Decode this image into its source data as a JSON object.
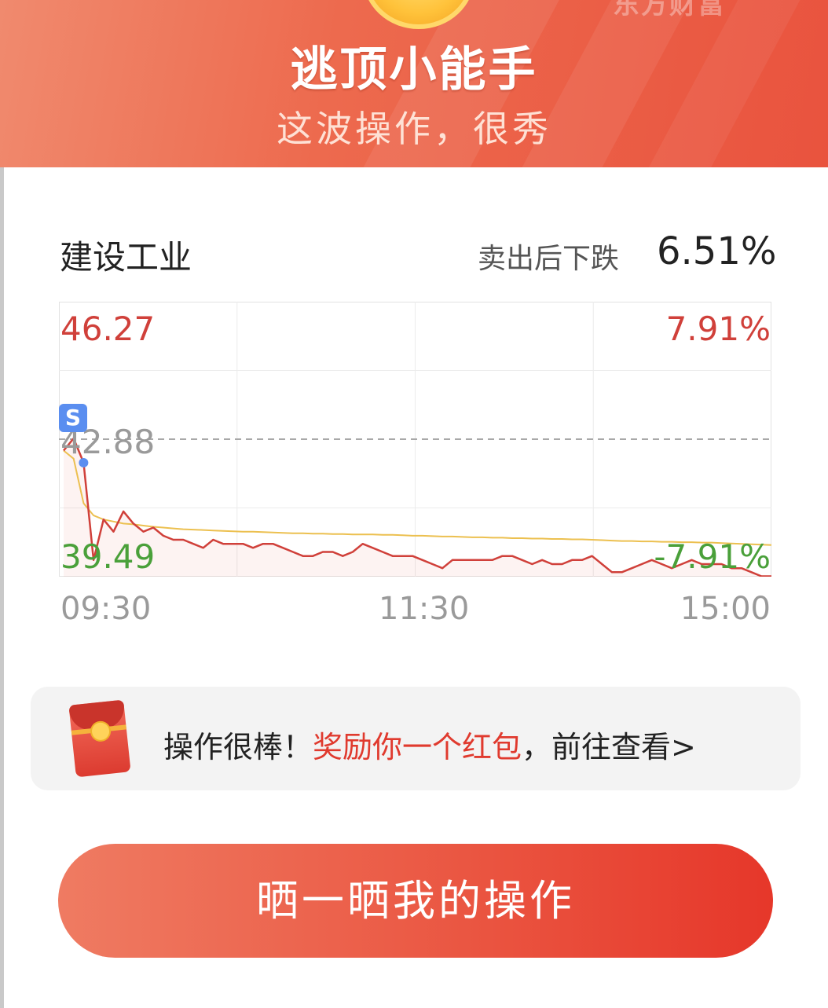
{
  "header": {
    "watermark": "东方财富",
    "title": "逃顶小能手",
    "subtitle": "这波操作，很秀"
  },
  "stock": {
    "name": "建设工业",
    "drop_label": "卖出后下跌",
    "drop_value": "6.51%"
  },
  "chart_data": {
    "type": "line",
    "y_labels": {
      "high": "46.27",
      "mid": "42.88",
      "low": "39.49",
      "high_pct": "7.91%",
      "low_pct": "-7.91%"
    },
    "ylim": [
      39.49,
      46.27
    ],
    "prev_close": 42.88,
    "x_ticks": [
      "09:30",
      "11:30",
      "15:00"
    ],
    "sell_marker": {
      "label": "S",
      "time_index": 2,
      "price": 42.3
    },
    "series": [
      {
        "values": [
          42.6,
          42.9,
          42.3,
          39.9,
          40.9,
          40.6,
          41.1,
          40.8,
          40.6,
          40.7,
          40.5,
          40.4,
          40.4,
          40.3,
          40.2,
          40.4,
          40.3,
          40.3,
          40.3,
          40.2,
          40.3,
          40.3,
          40.2,
          40.1,
          40.0,
          40.0,
          40.1,
          40.1,
          40.0,
          40.1,
          40.3,
          40.2,
          40.1,
          40.0,
          40.0,
          40.0,
          39.9,
          39.8,
          39.7,
          39.9,
          39.9,
          39.9,
          39.9,
          39.9,
          40.0,
          40.0,
          39.9,
          39.8,
          39.9,
          39.8,
          39.8,
          39.9,
          39.9,
          40.0,
          39.8,
          39.6,
          39.6,
          39.7,
          39.8,
          39.9,
          39.8,
          39.7,
          39.8,
          39.9,
          39.8,
          39.8,
          39.8,
          39.7,
          39.7,
          39.6,
          39.5,
          39.5
        ]
      },
      {
        "values": [
          42.6,
          42.4,
          41.3,
          41.0,
          40.9,
          40.85,
          40.8,
          40.78,
          40.75,
          40.72,
          40.7,
          40.68,
          40.66,
          40.65,
          40.64,
          40.63,
          40.62,
          40.61,
          40.6,
          40.6,
          40.59,
          40.58,
          40.57,
          40.56,
          40.56,
          40.55,
          40.55,
          40.54,
          40.54,
          40.53,
          40.53,
          40.53,
          40.52,
          40.52,
          40.51,
          40.5,
          40.5,
          40.49,
          40.48,
          40.48,
          40.47,
          40.46,
          40.46,
          40.45,
          40.45,
          40.44,
          40.44,
          40.43,
          40.43,
          40.42,
          40.42,
          40.41,
          40.41,
          40.4,
          40.39,
          40.38,
          40.37,
          40.37,
          40.36,
          40.36,
          40.35,
          40.35,
          40.34,
          40.34,
          40.33,
          40.33,
          40.32,
          40.31,
          40.3,
          40.29,
          40.28,
          40.27
        ]
      }
    ],
    "grid": true
  },
  "reward": {
    "prefix": "操作很棒！",
    "highlight": "奖励你一个红包",
    "suffix": "，前往查看>"
  },
  "share_button": {
    "label": "晒一晒我的操作"
  },
  "colors": {
    "price_line": "#d0403a",
    "avg_line": "#ecc050",
    "up": "#d0403a",
    "down": "#4aa03a",
    "accent": "#e6372a"
  }
}
